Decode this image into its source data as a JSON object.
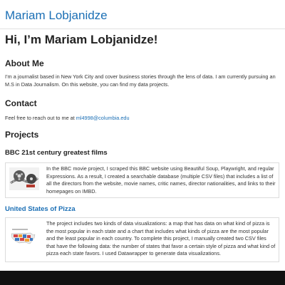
{
  "header": {
    "site_title": "Mariam Lobjanidze"
  },
  "hero": {
    "heading": "Hi, I’m Mariam Lobjanidze!"
  },
  "about": {
    "heading": "About Me",
    "text": "I’m a journalist based in New York City and cover business stories through the lens of data. I am currently pursuing an M.S in Data Journalism. On this website, you can find my data projects."
  },
  "contact": {
    "heading": "Contact",
    "prefix": "Feel free to reach out to me at ",
    "email": "ml4998@columbia.edu"
  },
  "projects": {
    "heading": "Projects",
    "items": [
      {
        "title": "BBC 21st century greatest films",
        "thumbnail_icon": "film-reel-icon",
        "description": "In the BBC movie project, I scraped this BBC website using Beautiful Soup, Playwright, and regular Expressions. As a result, I created a searchable database (multiple CSV files) that includes a list of all the directors from the website, movie names, critic names, director nationalities, and links to their homepages on IMBD."
      },
      {
        "title": "United States of Pizza",
        "thumbnail_icon": "us-map-icon",
        "description": "The project includes two kinds of data visualizations: a map that has data on what kind of pizza is the most popular in each state and a chart that includes what kinds of pizza are the most popular and the least popular in each country. To complete this project, I manually created two CSV files that have the following data: the number of states that favor a certain style of pizza and what kind of pizza each state favors. I used Datawrapper to generate data visualizations."
      }
    ]
  },
  "colors": {
    "link": "#1b6fb5",
    "text": "#222222",
    "footer": "#111111"
  }
}
